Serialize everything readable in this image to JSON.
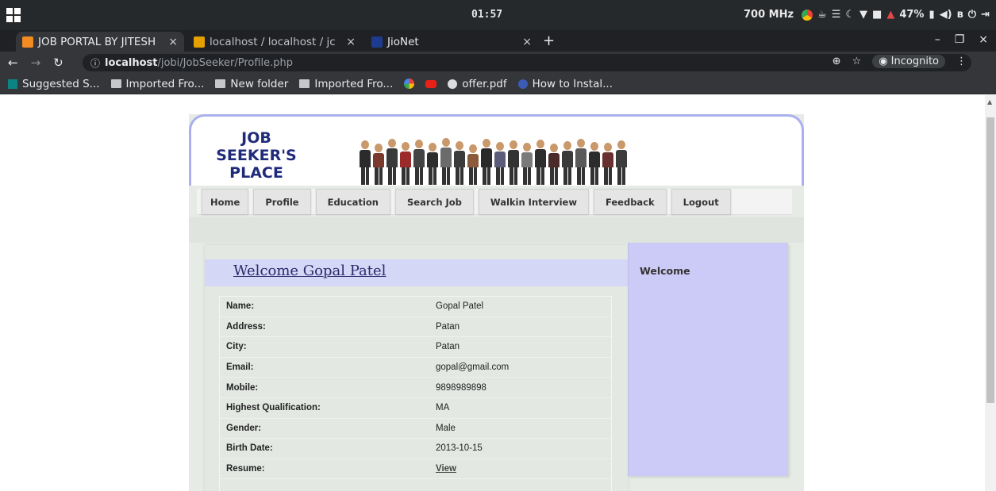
{
  "os": {
    "clock": "01:57",
    "cpu": "700 MHz",
    "battery": "47%"
  },
  "tabs": [
    {
      "label": "JOB PORTAL BY JITESH",
      "favicon_color": "#f28b22",
      "active": true
    },
    {
      "label": "localhost / localhost / jc",
      "favicon_color": "#e5a000",
      "active": false
    },
    {
      "label": "JioNet",
      "favicon_color": "#1d3c8f",
      "active": false
    }
  ],
  "toolbar": {
    "url_host": "localhost",
    "url_path": "/jobi/JobSeeker/Profile.php",
    "incognito_label": "Incognito"
  },
  "bookmarks": [
    {
      "label": "Suggested S...",
      "icon": "bing-icon"
    },
    {
      "label": "Imported Fro...",
      "icon": "folder-icon"
    },
    {
      "label": "New folder",
      "icon": "folder-icon"
    },
    {
      "label": "Imported Fro...",
      "icon": "folder-icon"
    },
    {
      "label": "",
      "icon": "google-icon"
    },
    {
      "label": "",
      "icon": "youtube-icon"
    },
    {
      "label": "offer.pdf",
      "icon": "globe-icon"
    },
    {
      "label": "How to Instal...",
      "icon": "site-icon"
    }
  ],
  "site": {
    "logo_lines": [
      "JOB",
      "SEEKER'S",
      "PLACE"
    ],
    "menu": [
      "Home",
      "Profile",
      "Education",
      "Search Job",
      "Walkin Interview",
      "Feedback",
      "Logout"
    ],
    "welcome_heading": "Welcome Gopal Patel",
    "sidebar_title": "Welcome",
    "profile": [
      {
        "label": "Name:",
        "value": "Gopal Patel"
      },
      {
        "label": "Address:",
        "value": "Patan"
      },
      {
        "label": "City:",
        "value": "Patan"
      },
      {
        "label": "Email:",
        "value": "gopal@gmail.com"
      },
      {
        "label": "Mobile:",
        "value": "9898989898"
      },
      {
        "label": "Highest Qualification:",
        "value": "MA"
      },
      {
        "label": "Gender:",
        "value": "Male"
      },
      {
        "label": "Birth Date:",
        "value": "2013-10-15"
      },
      {
        "label": "Resume:",
        "value": "View"
      }
    ]
  },
  "colors": {
    "header_border": "#aab0ee",
    "welcome_band": "#d5d7f7",
    "sidebar": "#cccaf6"
  }
}
